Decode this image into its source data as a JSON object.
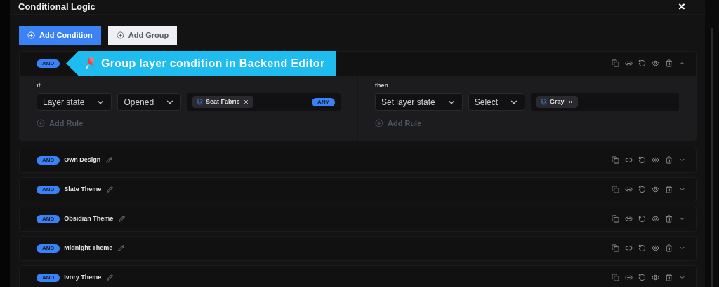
{
  "dialog": {
    "title": "Conditional Logic",
    "close": "×"
  },
  "buttons": [
    {
      "label": "Add Condition",
      "kind": "primary"
    },
    {
      "label": "Add Group",
      "kind": "secondary"
    }
  ],
  "callout": "Group layer condition in Backend Editor",
  "groups": [
    {
      "operator": "AND",
      "expanded": true,
      "if": {
        "label": "if",
        "selects": [
          "Layer state",
          "Opened"
        ],
        "tags": [
          "Seat Fabric"
        ],
        "match": "ANY",
        "add_rule": "Add Rule"
      },
      "then": {
        "label": "then",
        "selects": [
          "Set layer state",
          "Select"
        ],
        "tags": [
          "Gray"
        ],
        "add_rule": "Add Rule"
      }
    },
    {
      "operator": "AND",
      "name": "Own Design",
      "expanded": false
    },
    {
      "operator": "AND",
      "name": "Slate Theme",
      "expanded": false
    },
    {
      "operator": "AND",
      "name": "Obsidian Theme",
      "expanded": false
    },
    {
      "operator": "AND",
      "name": "Midnight Theme",
      "expanded": false
    },
    {
      "operator": "AND",
      "name": "Ivory Theme",
      "expanded": false
    }
  ]
}
